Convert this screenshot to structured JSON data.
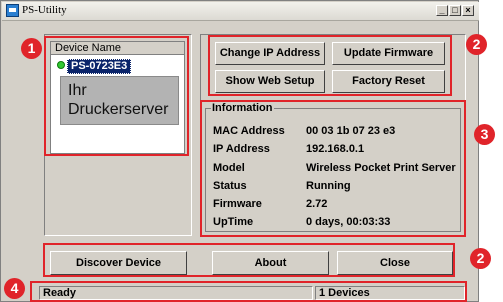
{
  "window": {
    "title": "PS-Utility"
  },
  "titlebar_buttons": {
    "minimize": "_",
    "maximize": "□",
    "close": "×"
  },
  "devices": {
    "header": "Device Name",
    "items": [
      {
        "name": "PS-0723E3",
        "status_color": "#32c832"
      }
    ]
  },
  "annotation": {
    "tooltip_line1": "Ihr",
    "tooltip_line2": "Druckerserver"
  },
  "actions": {
    "change_ip": "Change IP Address",
    "update_firmware": "Update Firmware",
    "show_web_setup": "Show Web Setup",
    "factory_reset": "Factory Reset"
  },
  "information": {
    "label": "Information",
    "rows": [
      {
        "key": "MAC Address",
        "value": "00 03 1b 07 23 e3"
      },
      {
        "key": "IP Address",
        "value": "192.168.0.1"
      },
      {
        "key": "Model",
        "value": "Wireless Pocket Print Server"
      },
      {
        "key": "Status",
        "value": "Running"
      },
      {
        "key": "Firmware",
        "value": "2.72"
      },
      {
        "key": "UpTime",
        "value": "0 days, 00:03:33"
      }
    ]
  },
  "bottom": {
    "discover": "Discover Device",
    "about": "About",
    "close": "Close"
  },
  "statusbar": {
    "state": "Ready",
    "device_count": "1 Devices"
  },
  "badges": {
    "b1": "1",
    "b2a": "2",
    "b3": "3",
    "b2b": "2",
    "b4": "4"
  },
  "colors": {
    "highlight": "#e0242a",
    "selection": "#0a246a",
    "window_bg": "#d4d0c8"
  }
}
